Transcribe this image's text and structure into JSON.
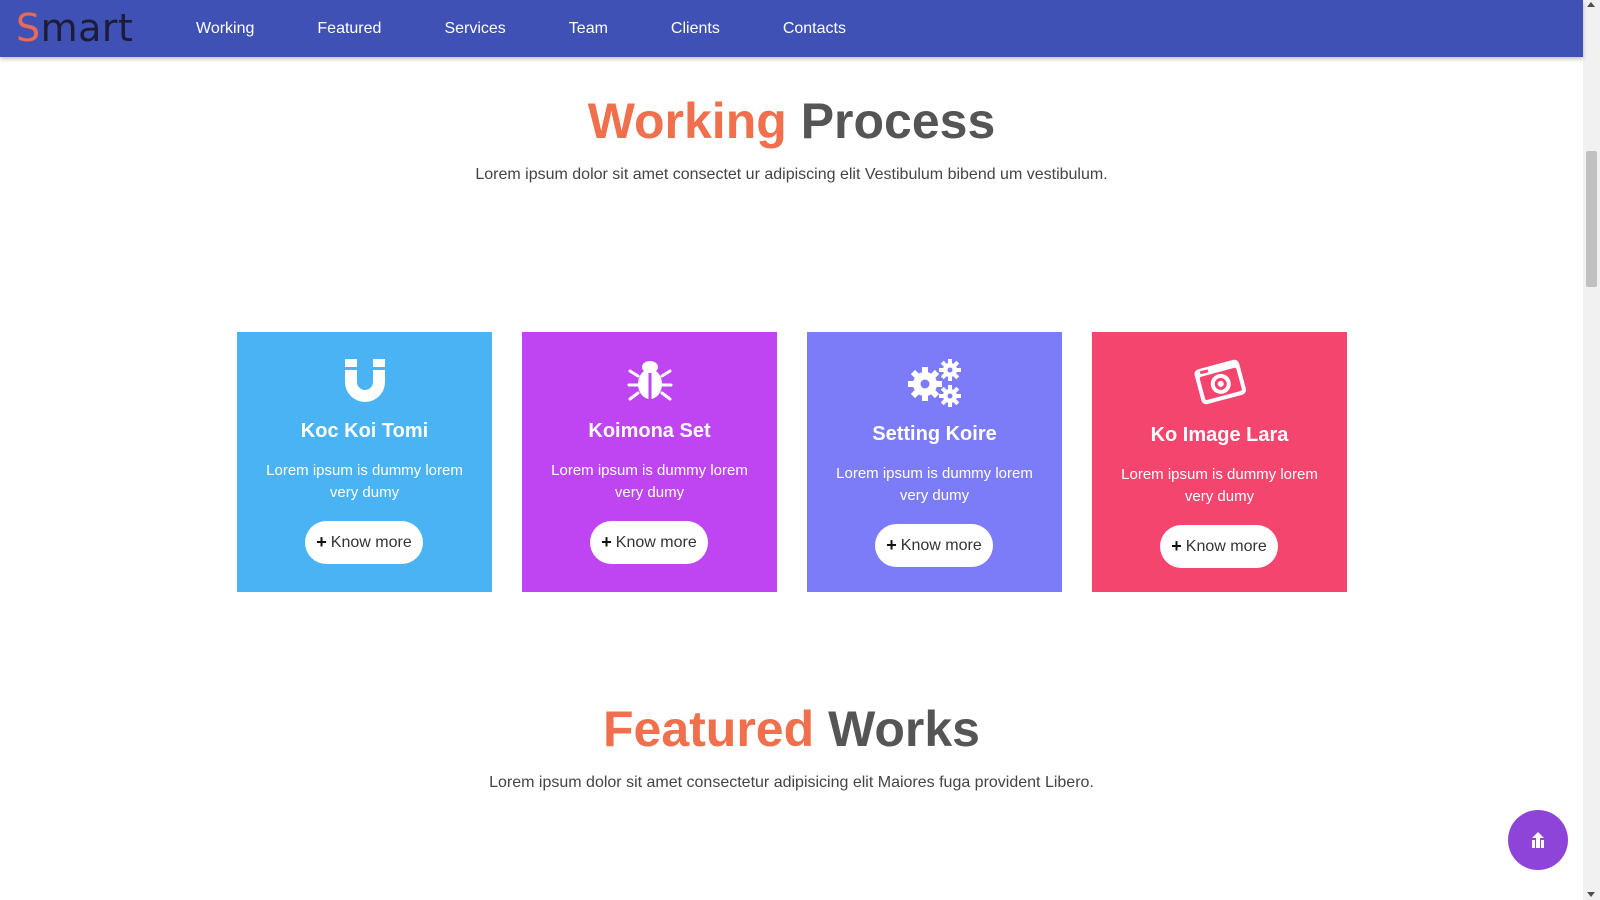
{
  "brand": {
    "first_letter": "S",
    "rest": "mart"
  },
  "nav": {
    "items": [
      {
        "label": "Working"
      },
      {
        "label": "Featured"
      },
      {
        "label": "Services"
      },
      {
        "label": "Team"
      },
      {
        "label": "Clients"
      },
      {
        "label": "Contacts"
      }
    ]
  },
  "working": {
    "title_accent": "Working",
    "title_rest": "Process",
    "subtitle": "Lorem ipsum dolor sit amet consectet ur adipiscing elit Vestibulum bibend um vestibulum."
  },
  "cards": [
    {
      "title": "Koc Koi Tomi",
      "text": "Lorem ipsum is dummy lorem very dumy",
      "button": "Know more",
      "icon": "magnet-icon",
      "color": "#4ab3f4"
    },
    {
      "title": "Koimona Set",
      "text": "Lorem ipsum is dummy lorem very dumy",
      "button": "Know more",
      "icon": "bug-icon",
      "color": "#bf45f2"
    },
    {
      "title": "Setting Koire",
      "text": "Lorem ipsum is dummy lorem very dumy",
      "button": "Know more",
      "icon": "gears-icon",
      "color": "#7d7cf8"
    },
    {
      "title": "Ko Image Lara",
      "text": "Lorem ipsum is dummy lorem very dumy",
      "button": "Know more",
      "icon": "camera-icon",
      "color": "#f4456e"
    }
  ],
  "featured": {
    "title_accent": "Featured",
    "title_rest": "Works",
    "subtitle": "Lorem ipsum dolor sit amet consectetur adipisicing elit Maiores fuga provident Libero."
  },
  "colors": {
    "nav_bg": "#3f51b5",
    "accent": "#f0704d",
    "to_top": "#8e44d9"
  },
  "to_top": {
    "icon": "double-arrow-up-icon"
  }
}
